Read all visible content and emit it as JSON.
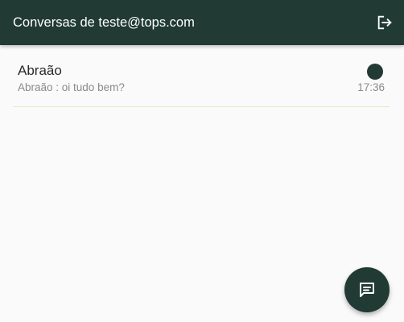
{
  "appbar": {
    "title": "Conversas de teste@tops.com",
    "logout_icon": "logout-icon"
  },
  "conversations": [
    {
      "name": "Abraão",
      "preview": "Abraão : oi tudo bem?",
      "time": "17:36",
      "unread_indicator": true
    }
  ],
  "fab": {
    "icon": "chat-icon"
  },
  "colors": {
    "primary": "#213a33",
    "background": "#fafafa",
    "divider": "#ece8c8",
    "secondary_text": "#8a8a8a"
  }
}
